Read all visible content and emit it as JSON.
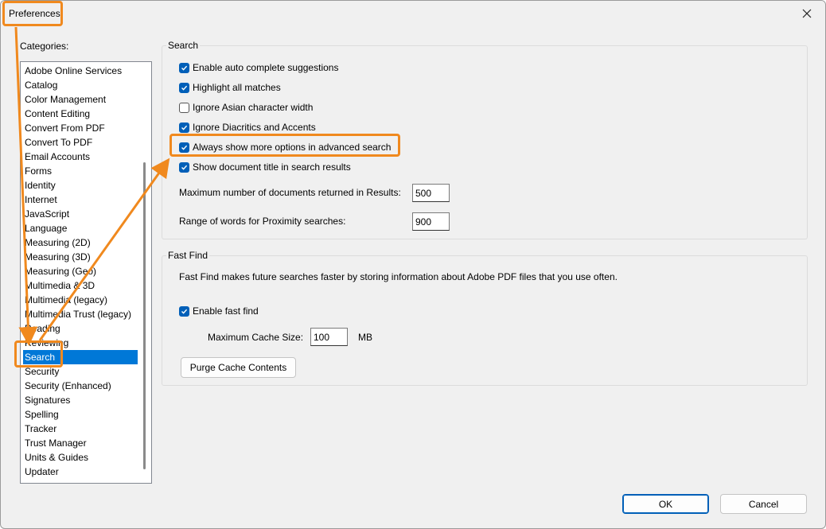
{
  "window": {
    "title": "Preferences"
  },
  "categories": {
    "label": "Categories:",
    "items": [
      "Adobe Online Services",
      "Catalog",
      "Color Management",
      "Content Editing",
      "Convert From PDF",
      "Convert To PDF",
      "Email Accounts",
      "Forms",
      "Identity",
      "Internet",
      "JavaScript",
      "Language",
      "Measuring (2D)",
      "Measuring (3D)",
      "Measuring (Geo)",
      "Multimedia & 3D",
      "Multimedia (legacy)",
      "Multimedia Trust (legacy)",
      "Reading",
      "Reviewing",
      "Search",
      "Security",
      "Security (Enhanced)",
      "Signatures",
      "Spelling",
      "Tracker",
      "Trust Manager",
      "Units & Guides",
      "Updater"
    ],
    "selected": "Search"
  },
  "search_group": {
    "title": "Search",
    "options": [
      {
        "label": "Enable auto complete suggestions",
        "checked": true
      },
      {
        "label": "Highlight all matches",
        "checked": true
      },
      {
        "label": "Ignore Asian character width",
        "checked": false
      },
      {
        "label": "Ignore Diacritics and Accents",
        "checked": true
      },
      {
        "label": "Always show more options in advanced search",
        "checked": true
      },
      {
        "label": "Show document title in search results",
        "checked": true
      }
    ],
    "max_docs_label": "Maximum number of documents returned in Results:",
    "max_docs_value": "500",
    "proximity_label": "Range of words for Proximity searches:",
    "proximity_value": "900"
  },
  "fast_find_group": {
    "title": "Fast Find",
    "description": "Fast Find makes future searches faster by storing information about Adobe PDF files that you use often.",
    "enable_label": "Enable fast find",
    "enable_checked": true,
    "cache_label": "Maximum Cache Size:",
    "cache_value": "100",
    "cache_unit": "MB",
    "purge_label": "Purge Cache Contents"
  },
  "footer": {
    "ok_label": "OK",
    "cancel_label": "Cancel"
  },
  "colors": {
    "accent": "#005fb8",
    "selection": "#0078d7",
    "annotation": "#f0891e"
  }
}
